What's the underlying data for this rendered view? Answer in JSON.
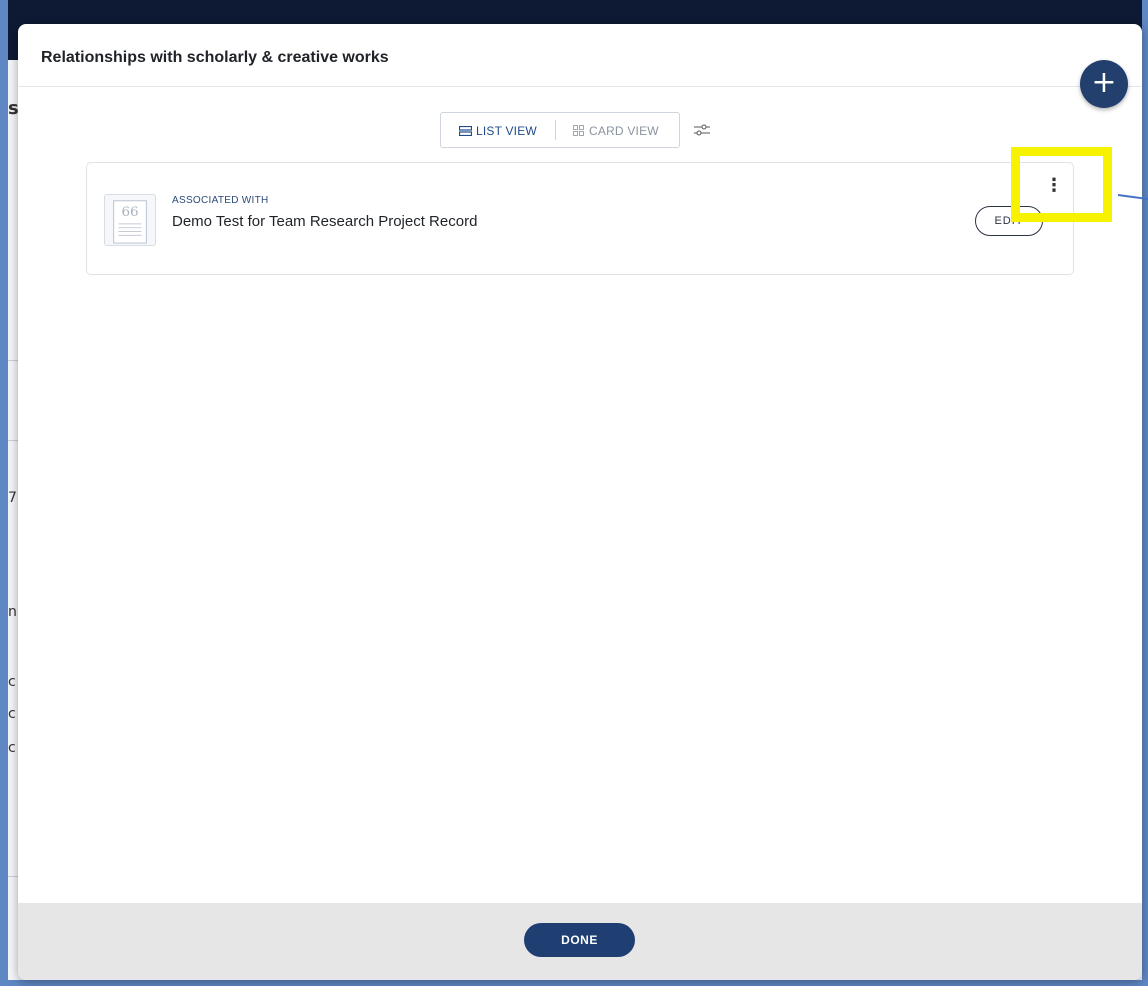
{
  "modal": {
    "title": "Relationships with scholarly & creative works",
    "add_icon": "plus-icon",
    "add_label": "+"
  },
  "view_toggle": {
    "list_label": "LIST VIEW",
    "card_label": "CARD VIEW",
    "active": "LIST VIEW",
    "list_icon": "list-view-icon",
    "card_icon": "grid-view-icon",
    "filter_icon": "sliders-icon"
  },
  "items": [
    {
      "type": "ASSOCIATED WITH",
      "title": "Demo Test for Team Research Project Record",
      "thumb_icon": "quote-document-icon",
      "edit_label": "EDIT",
      "more_icon": "more-vertical-icon",
      "more_label": "⋮"
    }
  ],
  "footer": {
    "done_label": "DONE"
  },
  "background": {
    "glyphs": [
      "s",
      "7",
      "n",
      "c",
      "c",
      "c"
    ]
  },
  "colors": {
    "primary": "#1f3e72",
    "highlight": "#f7f300",
    "topbar": "#0e1a33"
  }
}
